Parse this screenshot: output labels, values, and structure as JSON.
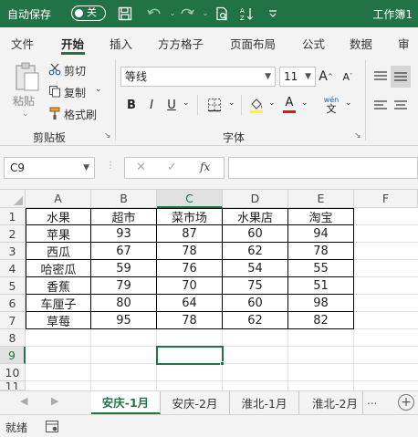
{
  "titlebar": {
    "autosave_label": "自动保存",
    "toggle_label": "关",
    "doc_title": "工作簿1"
  },
  "menu": {
    "items": [
      "文件",
      "开始",
      "插入",
      "方方格子",
      "页面布局",
      "公式",
      "数据",
      "审阅"
    ],
    "active": "开始"
  },
  "ribbon": {
    "clipboard": {
      "paste_label": "粘贴",
      "cut_label": "剪切",
      "copy_label": "复制",
      "format_painter_label": "格式刷",
      "group_label": "剪贴板"
    },
    "font": {
      "font_name": "等线",
      "font_size": "11",
      "group_label": "字体",
      "bold": "B",
      "italic": "I",
      "underline": "U",
      "grow": "A",
      "shrink": "A",
      "font_color_letter": "A",
      "phonetic": "wén"
    }
  },
  "formula_bar": {
    "name_box": "C9",
    "fx": "fx",
    "formula": ""
  },
  "grid": {
    "columns": [
      "A",
      "B",
      "C",
      "D",
      "E",
      "F"
    ],
    "rows": [
      "1",
      "2",
      "3",
      "4",
      "5",
      "6",
      "7",
      "8",
      "9",
      "10",
      "11"
    ],
    "data": [
      [
        "水果",
        "超市",
        "菜市场",
        "水果店",
        "淘宝"
      ],
      [
        "苹果",
        "93",
        "87",
        "60",
        "94"
      ],
      [
        "西瓜",
        "67",
        "78",
        "62",
        "78"
      ],
      [
        "哈密瓜",
        "59",
        "76",
        "54",
        "55"
      ],
      [
        "香蕉",
        "79",
        "70",
        "75",
        "51"
      ],
      [
        "车厘子",
        "80",
        "64",
        "60",
        "98"
      ],
      [
        "草莓",
        "95",
        "78",
        "62",
        "82"
      ]
    ],
    "active_cell": "C9"
  },
  "sheets": {
    "tabs": [
      "安庆-1月",
      "安庆-2月",
      "淮北-1月",
      "淮北-2月"
    ],
    "active": "安庆-1月",
    "overflow": "..."
  },
  "status": {
    "ready": "就绪"
  },
  "colors": {
    "accent": "#217346"
  }
}
